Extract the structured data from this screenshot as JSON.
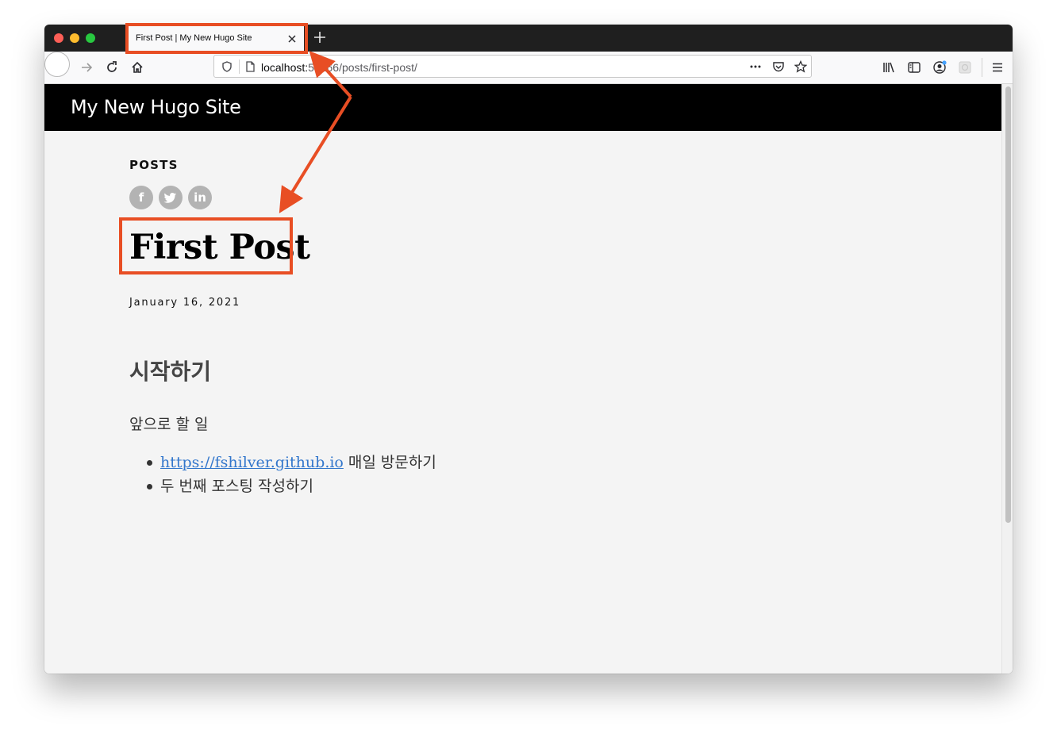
{
  "browser": {
    "tab_title": "First Post | My New Hugo Site",
    "url_host": "localhost:",
    "url_port_partial": "54266",
    "url_path": "/posts/first-post/"
  },
  "site": {
    "title": "My New Hugo Site"
  },
  "post": {
    "section": "POSTS",
    "title": "First Post",
    "date": "January 16, 2021",
    "heading": "시작하기",
    "paragraph": "앞으로 할 일",
    "list_items": [
      {
        "link_text": "https://fshilver.github.io",
        "suffix": " 매일 방문하기"
      },
      {
        "text": "두 번째 포스팅 작성하기"
      }
    ],
    "social": [
      {
        "icon": "facebook-icon",
        "glyph": "f"
      },
      {
        "icon": "twitter-icon",
        "glyph": "t"
      },
      {
        "icon": "linkedin-icon",
        "glyph": "in"
      }
    ]
  },
  "colors": {
    "annotation": "#e84e24",
    "header_bg": "#000000",
    "link": "#3377cc",
    "social_icon": "#b3b3b3"
  }
}
